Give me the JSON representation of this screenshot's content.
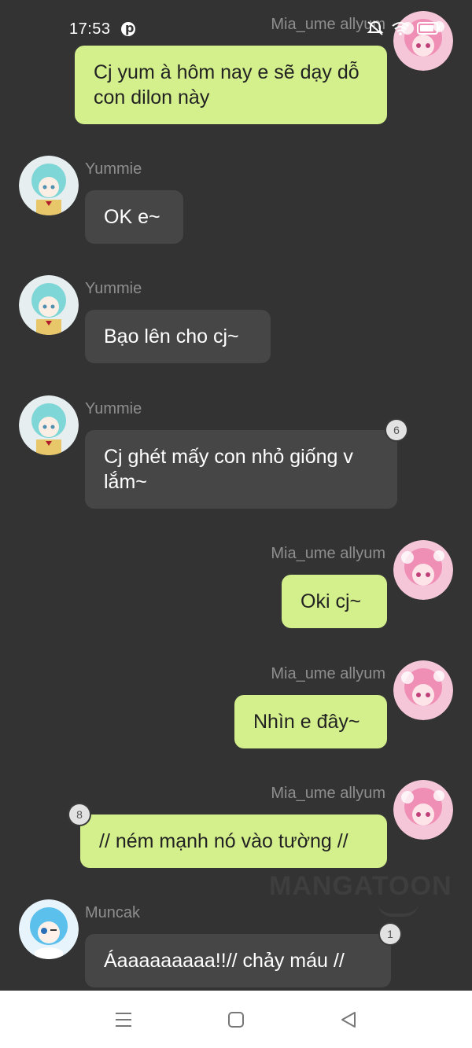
{
  "status_bar": {
    "time": "17:53",
    "app_icon": "pinterest-icon",
    "icons": [
      "mute-icon",
      "wifi-icon",
      "battery-icon"
    ]
  },
  "messages": [
    {
      "side": "me",
      "sender": "Mia_ume allyum",
      "text": "Cj yum à hôm nay e sẽ dạy dỗ con dilon này",
      "badge": ""
    },
    {
      "side": "them",
      "sender": "Yummie",
      "text": "OK e~",
      "badge": ""
    },
    {
      "side": "them",
      "sender": "Yummie",
      "text": "Bạo lên cho cj~",
      "badge": ""
    },
    {
      "side": "them",
      "sender": "Yummie",
      "text": "Cj ghét mấy con nhỏ giống v lắm~",
      "badge": "6"
    },
    {
      "side": "me",
      "sender": "Mia_ume allyum",
      "text": "Oki cj~",
      "badge": ""
    },
    {
      "side": "me",
      "sender": "Mia_ume allyum",
      "text": "Nhìn e đây~",
      "badge": ""
    },
    {
      "side": "me",
      "sender": "Mia_ume allyum",
      "text": "// ném mạnh nó vào tường //",
      "badge": "8"
    },
    {
      "side": "them",
      "sender": "Muncak",
      "text": "Áaaaaaaaaa!!// chảy máu //",
      "badge": "1"
    }
  ],
  "watermark": "MANGATOON",
  "colors": {
    "background": "#333333",
    "my_bubble": "#d4f08c",
    "their_bubble": "#464646",
    "sender_name": "#8e8e8e"
  },
  "navigation": {
    "menu": "menu-icon",
    "home": "home-icon",
    "back": "back-icon"
  }
}
